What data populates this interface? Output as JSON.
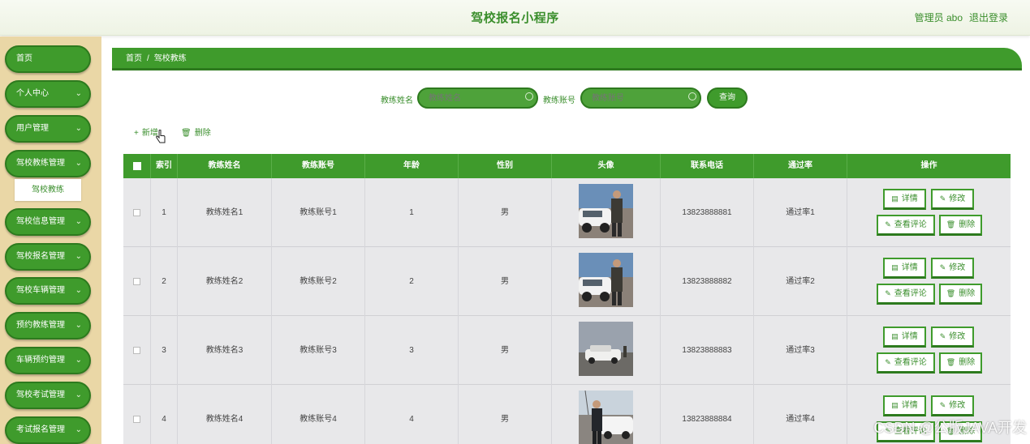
{
  "header": {
    "title": "驾校报名小程序",
    "user": "管理员 abo",
    "logout": "退出登录"
  },
  "sidebar": {
    "items": [
      {
        "label": "首页",
        "has_chevron": false
      },
      {
        "label": "个人中心",
        "has_chevron": true
      },
      {
        "label": "用户管理",
        "has_chevron": true
      },
      {
        "label": "驾校教练管理",
        "has_chevron": true
      },
      {
        "label": "驾校信息管理",
        "has_chevron": true
      },
      {
        "label": "驾校报名管理",
        "has_chevron": true
      },
      {
        "label": "驾校车辆管理",
        "has_chevron": true
      },
      {
        "label": "预约教练管理",
        "has_chevron": true
      },
      {
        "label": "车辆预约管理",
        "has_chevron": true
      },
      {
        "label": "驾校考试管理",
        "has_chevron": true
      },
      {
        "label": "考试报名管理",
        "has_chevron": true
      }
    ],
    "subitem": "驾校教练"
  },
  "breadcrumb": {
    "home": "首页",
    "separator": "/",
    "current": "驾校教练"
  },
  "search": {
    "name_label": "教练姓名",
    "name_placeholder": "教练姓名",
    "account_label": "教练账号",
    "account_placeholder": "教练账号",
    "button": "查询"
  },
  "actions": {
    "add": "新增",
    "delete": "删除"
  },
  "table": {
    "columns": [
      "索引",
      "教练姓名",
      "教练账号",
      "年龄",
      "性别",
      "头像",
      "联系电话",
      "通过率",
      "操作"
    ],
    "rows": [
      {
        "index": "1",
        "name": "教练姓名1",
        "account": "教练账号1",
        "age": "1",
        "gender": "男",
        "phone": "13823888881",
        "rate": "通过率1",
        "photo": "coach-by-car"
      },
      {
        "index": "2",
        "name": "教练姓名2",
        "account": "教练账号2",
        "age": "2",
        "gender": "男",
        "phone": "13823888882",
        "rate": "通过率2",
        "photo": "coach-by-car"
      },
      {
        "index": "3",
        "name": "教练姓名3",
        "account": "教练账号3",
        "age": "3",
        "gender": "男",
        "phone": "13823888883",
        "rate": "通过率3",
        "photo": "car-on-road"
      },
      {
        "index": "4",
        "name": "教练姓名4",
        "account": "教练账号4",
        "age": "4",
        "gender": "男",
        "phone": "13823888884",
        "rate": "通过率4",
        "photo": "coach-and-cars"
      }
    ],
    "row_buttons": {
      "detail": "详情",
      "edit": "修改",
      "reviews": "查看评论",
      "delete": "删除"
    }
  },
  "watermark": "CSDN @公版JAVA开发",
  "colors": {
    "primary": "#3f9b2c",
    "primary_dark": "#2d7a1e",
    "sidebar_bg": "#ead7a6",
    "row_bg": "#e8e8ea"
  }
}
